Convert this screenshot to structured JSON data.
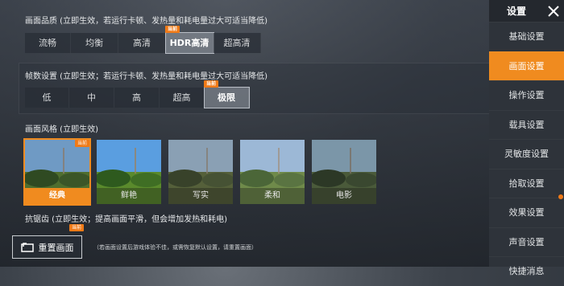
{
  "sidebar": {
    "title": "设置",
    "items": [
      {
        "label": "基础设置",
        "active": false
      },
      {
        "label": "画面设置",
        "active": true
      },
      {
        "label": "操作设置",
        "active": false
      },
      {
        "label": "载具设置",
        "active": false
      },
      {
        "label": "灵敏度设置",
        "active": false
      },
      {
        "label": "拾取设置",
        "active": false
      },
      {
        "label": "效果设置",
        "active": false
      },
      {
        "label": "声音设置",
        "active": false
      },
      {
        "label": "快捷消息",
        "active": false
      }
    ],
    "accent": "#f08b1f"
  },
  "quality": {
    "label": "画面品质 (立即生效，若运行卡顿、发热量和耗电量过大可适当降低)",
    "options": [
      "流畅",
      "均衡",
      "高清",
      "HDR高清",
      "超高清"
    ],
    "selected": "HDR高清",
    "tag": "当前"
  },
  "framerate": {
    "label": "帧数设置 (立即生效；若运行卡顿、发热量和耗电量过大可适当降低)",
    "options": [
      "低",
      "中",
      "高",
      "超高",
      "极限"
    ],
    "selected": "极限",
    "tag": "当前"
  },
  "style": {
    "label": "画面风格 (立即生效)",
    "options": [
      "经典",
      "鲜艳",
      "写实",
      "柔和",
      "电影"
    ],
    "selected": "经典",
    "tag": "当前"
  },
  "antialias": {
    "label": "抗锯齿 (立即生效；提高画面平滑，但会增加发热和耗电)",
    "tag": "当前"
  },
  "reset": {
    "label": "重置画面",
    "hint": "（若画面设置后游戏体验不佳，或需恢复默认设置，请重置画面）"
  }
}
